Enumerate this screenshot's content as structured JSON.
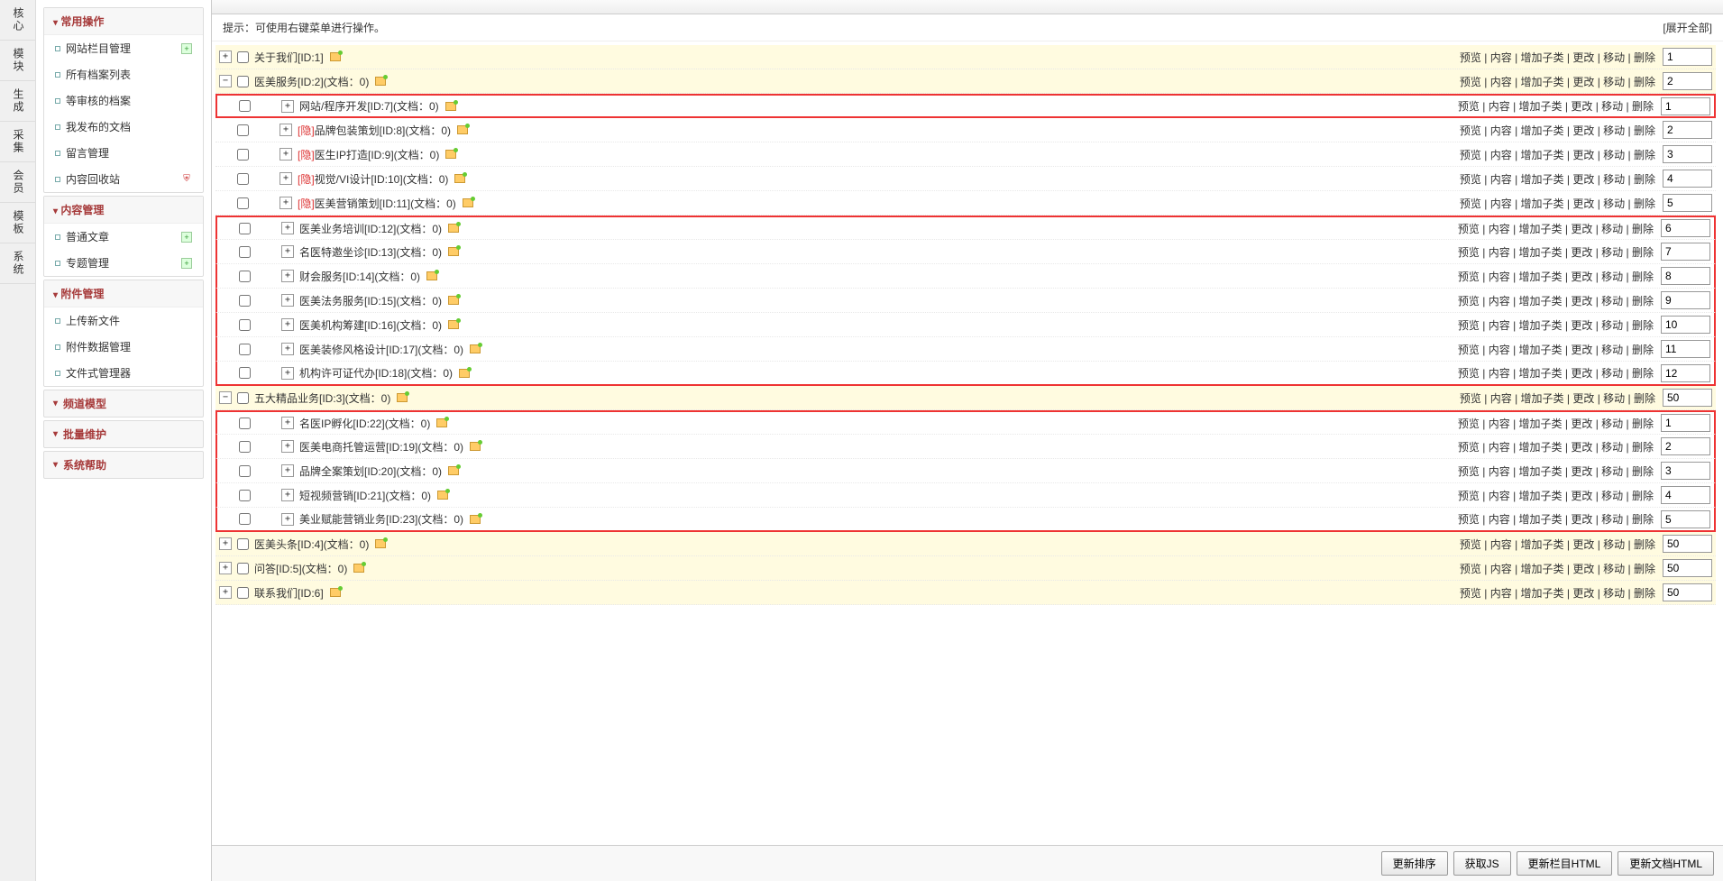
{
  "sidebar_tabs": [
    "核心",
    "模块",
    "生成",
    "采集",
    "会员",
    "模板",
    "系统"
  ],
  "menu": {
    "common": {
      "title": "常用操作",
      "items": [
        {
          "label": "网站栏目管理",
          "add": true
        },
        {
          "label": "所有档案列表"
        },
        {
          "label": "等审核的档案"
        },
        {
          "label": "我发布的文档"
        },
        {
          "label": "留言管理"
        },
        {
          "label": "内容回收站",
          "shield": true
        }
      ]
    },
    "content": {
      "title": "内容管理",
      "items": [
        {
          "label": "普通文章",
          "add": true
        },
        {
          "label": "专题管理",
          "add": true
        }
      ]
    },
    "attach": {
      "title": "附件管理",
      "items": [
        {
          "label": "上传新文件"
        },
        {
          "label": "附件数据管理"
        },
        {
          "label": "文件式管理器"
        }
      ]
    },
    "stubs": [
      "频道模型",
      "批量维护",
      "系统帮助"
    ]
  },
  "hint": "提示：可使用右键菜单进行操作。",
  "expand_all": "[展开全部]",
  "actions": [
    "预览",
    "内容",
    "增加子类",
    "更改",
    "移动",
    "删除"
  ],
  "rows": [
    {
      "exp": "+",
      "chk": true,
      "indent": 0,
      "label": "关于我们[ID:1]",
      "order": "1",
      "hl": true
    },
    {
      "exp": "-",
      "chk": true,
      "indent": 0,
      "label": "医美服务[ID:2](文档：0)",
      "order": "2",
      "hl": true
    },
    {
      "chk": true,
      "exp2": "+",
      "indent": 28,
      "label": "网站/程序开发[ID:7](文档：0)",
      "order": "1",
      "box": "single"
    },
    {
      "chk": true,
      "exp2": "+",
      "indent": 28,
      "hidden": true,
      "label": "品牌包装策划[ID:8](文档：0)",
      "order": "2"
    },
    {
      "chk": true,
      "exp2": "+",
      "indent": 28,
      "hidden": true,
      "label": "医生IP打造[ID:9](文档：0)",
      "order": "3"
    },
    {
      "chk": true,
      "exp2": "+",
      "indent": 28,
      "hidden": true,
      "label": "视觉/VI设计[ID:10](文档：0)",
      "order": "4"
    },
    {
      "chk": true,
      "exp2": "+",
      "indent": 28,
      "hidden": true,
      "label": "医美营销策划[ID:11](文档：0)",
      "order": "5"
    },
    {
      "chk": true,
      "exp2": "+",
      "indent": 28,
      "label": "医美业务培训[ID:12](文档：0)",
      "order": "6",
      "box": "top"
    },
    {
      "chk": true,
      "exp2": "+",
      "indent": 28,
      "label": "名医特邀坐诊[ID:13](文档：0)",
      "order": "7",
      "box": "mid"
    },
    {
      "chk": true,
      "exp2": "+",
      "indent": 28,
      "label": "财会服务[ID:14](文档：0)",
      "order": "8",
      "box": "mid"
    },
    {
      "chk": true,
      "exp2": "+",
      "indent": 28,
      "label": "医美法务服务[ID:15](文档：0)",
      "order": "9",
      "box": "mid"
    },
    {
      "chk": true,
      "exp2": "+",
      "indent": 28,
      "label": "医美机构筹建[ID:16](文档：0)",
      "order": "10",
      "box": "mid"
    },
    {
      "chk": true,
      "exp2": "+",
      "indent": 28,
      "label": "医美装修风格设计[ID:17](文档：0)",
      "order": "11",
      "box": "mid"
    },
    {
      "chk": true,
      "exp2": "+",
      "indent": 28,
      "label": "机构许可证代办[ID:18](文档：0)",
      "order": "12",
      "box": "bot"
    },
    {
      "exp": "-",
      "chk": true,
      "indent": 0,
      "label": "五大精品业务[ID:3](文档：0)",
      "order": "50",
      "hl": true
    },
    {
      "chk": true,
      "exp2": "+",
      "indent": 28,
      "label": "名医IP孵化[ID:22](文档：0)",
      "order": "1",
      "box": "top"
    },
    {
      "chk": true,
      "exp2": "+",
      "indent": 28,
      "label": "医美电商托管运营[ID:19](文档：0)",
      "order": "2",
      "box": "mid"
    },
    {
      "chk": true,
      "exp2": "+",
      "indent": 28,
      "label": "品牌全案策划[ID:20](文档：0)",
      "order": "3",
      "box": "mid"
    },
    {
      "chk": true,
      "exp2": "+",
      "indent": 28,
      "label": "短视频营销[ID:21](文档：0)",
      "order": "4",
      "box": "mid"
    },
    {
      "chk": true,
      "exp2": "+",
      "indent": 28,
      "label": "美业赋能营销业务[ID:23](文档：0)",
      "order": "5",
      "box": "bot"
    },
    {
      "exp": "+",
      "chk": true,
      "indent": 0,
      "label": "医美头条[ID:4](文档：0)",
      "order": "50",
      "hl": true
    },
    {
      "exp": "+",
      "chk": true,
      "indent": 0,
      "label": "问答[ID:5](文档：0)",
      "order": "50",
      "hl": true
    },
    {
      "exp": "+",
      "chk": true,
      "indent": 0,
      "label": "联系我们[ID:6]",
      "order": "50",
      "hl": true
    }
  ],
  "hidden_prefix": "[隐]",
  "footer_buttons": [
    "更新排序",
    "获取JS",
    "更新栏目HTML",
    "更新文档HTML"
  ]
}
